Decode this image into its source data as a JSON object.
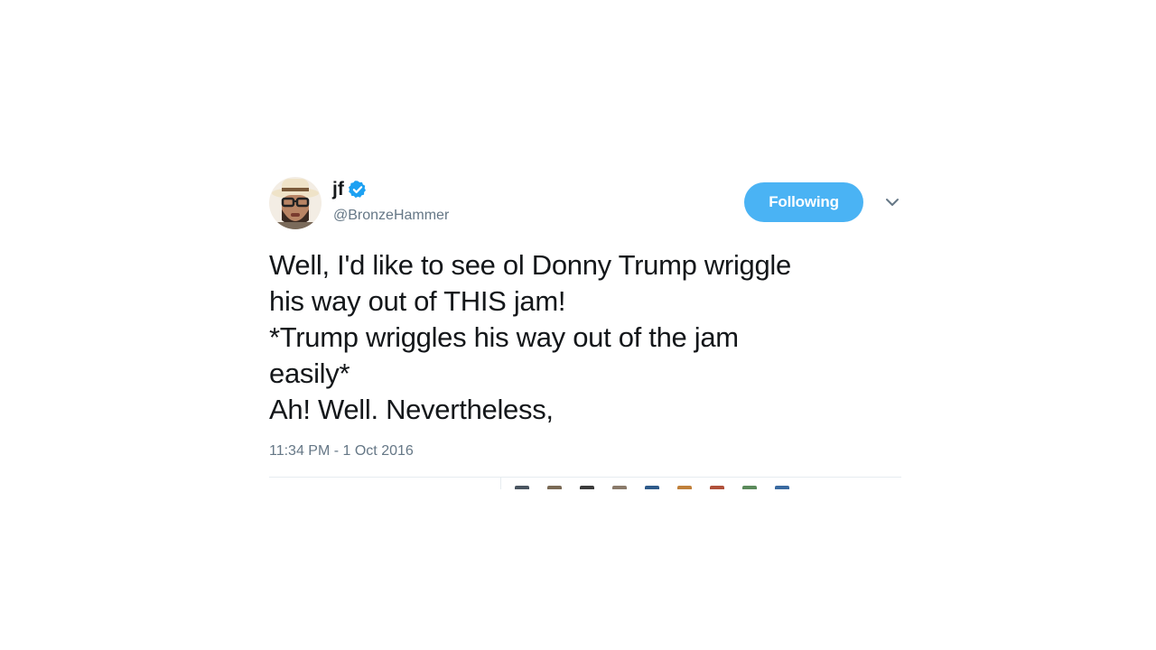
{
  "tweet": {
    "display_name": "jf",
    "handle": "@BronzeHammer",
    "verified_icon": "verified-badge-icon",
    "follow_button_label": "Following",
    "menu_icon": "chevron-down-icon",
    "text_lines": [
      "Well, I'd like to see ol Donny Trump wriggle",
      "his way out of THIS jam!",
      "*Trump wriggles his way out of the jam",
      "easily*",
      "Ah! Well. Nevertheless,"
    ],
    "timestamp": "11:34 PM - 1 Oct 2016"
  },
  "colors": {
    "accent": "#4ab3f4",
    "verified": "#1da1f2",
    "text": "#14171a",
    "secondary": "#657786",
    "divider": "#e6ecf0"
  }
}
